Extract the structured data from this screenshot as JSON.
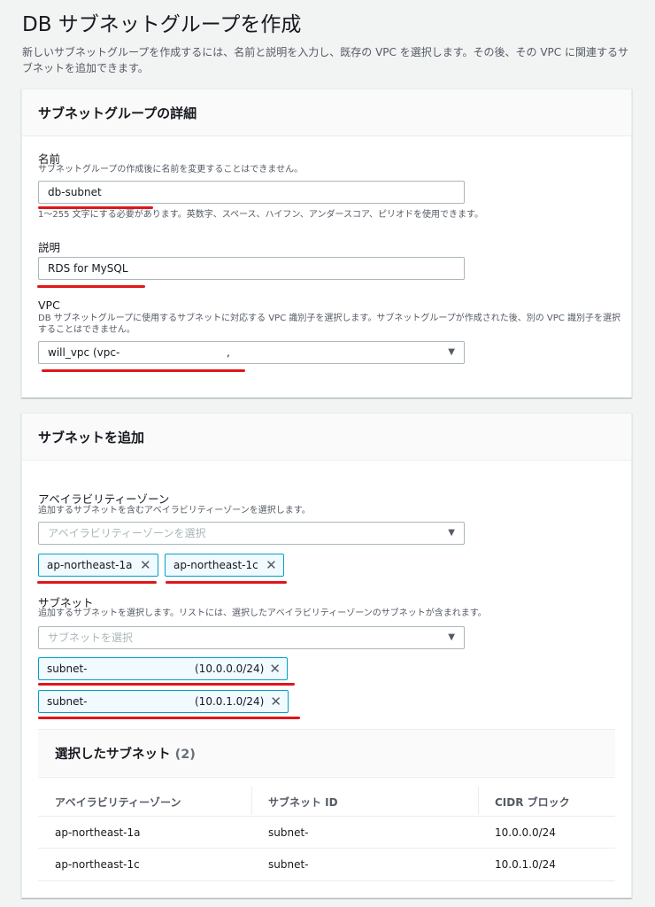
{
  "page": {
    "title": "DB サブネットグループを作成",
    "description": "新しいサブネットグループを作成するには、名前と説明を入力し、既存の VPC を選択します。その後、その VPC に関連するサブネットを追加できます。"
  },
  "details": {
    "header": "サブネットグループの詳細",
    "name": {
      "label": "名前",
      "desc": "サブネットグループの作成後に名前を変更することはできません。",
      "value": "db-subnet",
      "constraint": "1〜255 文字にする必要があります。英数字、スペース、ハイフン、アンダースコア、ピリオドを使用できます。"
    },
    "description_field": {
      "label": "説明",
      "value": "RDS for MySQL"
    },
    "vpc": {
      "label": "VPC",
      "desc": "DB サブネットグループに使用するサブネットに対応する VPC 識別子を選択します。サブネットグループが作成された後、別の VPC 識別子を選択することはできません。",
      "value": "will_vpc (vpc-",
      "tail": ","
    }
  },
  "add_subnets": {
    "header": "サブネットを追加",
    "az": {
      "label": "アベイラビリティーゾーン",
      "desc": "追加するサブネットを含むアベイラビリティーゾーンを選択します。",
      "placeholder": "アベイラビリティーゾーンを選択",
      "tokens": [
        "ap-northeast-1a",
        "ap-northeast-1c"
      ]
    },
    "subnet": {
      "label": "サブネット",
      "desc": "追加するサブネットを選択します。リストには、選択したアベイラビリティーゾーンのサブネットが含まれます。",
      "placeholder": "サブネットを選択",
      "tokens": [
        {
          "prefix": "subnet-",
          "cidr": "(10.0.0.0/24)"
        },
        {
          "prefix": "subnet-",
          "cidr": "(10.0.1.0/24)"
        }
      ]
    },
    "selected": {
      "title": "選択したサブネット",
      "count": "(2)",
      "columns": [
        "アベイラビリティーゾーン",
        "サブネット ID",
        "CIDR ブロック"
      ],
      "rows": [
        [
          "ap-northeast-1a",
          "subnet-",
          "10.0.0.0/24"
        ],
        [
          "ap-northeast-1c",
          "subnet-",
          "10.0.1.0/24"
        ]
      ]
    }
  },
  "colors": {
    "accent": "#00a1c9",
    "annotation": "#e0161a"
  }
}
